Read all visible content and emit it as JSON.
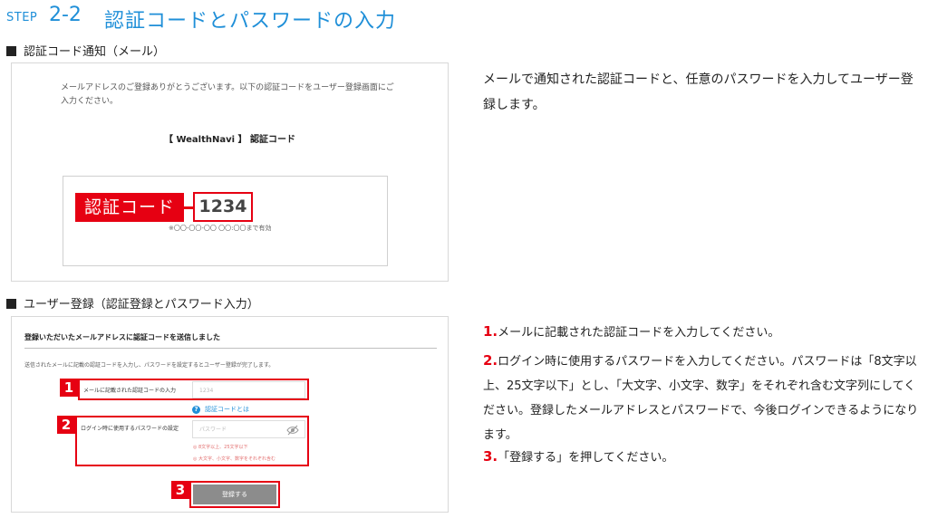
{
  "heading": {
    "step_label": "STEP",
    "step_number": "2-2",
    "title": "認証コードとパスワードの入力"
  },
  "section_email": {
    "title": "認証コード通知（メール）",
    "mail_body": "メールアドレスのご登録ありがとうございます。以下の認証コードをユーザー登録画面にご入力ください。",
    "brand_line": "【 WealthNavi 】 認証コード",
    "code_tag": "認証コード",
    "code_value": "1234",
    "valid_until": "※〇〇-〇〇-〇〇 〇〇:〇〇まで有効"
  },
  "intro_text": "メールで通知された認証コードと、任意のパスワードを入力してユーザー登録します。",
  "section_register": {
    "title": "ユーザー登録（認証登録とパスワード入力）",
    "form_title": "登録いただいたメールアドレスに認証コードを送信しました",
    "form_desc": "送信されたメールに記載の認証コードを入力し、パスワードを設定するとユーザー登録が完了します。",
    "field1_label": "メールに記載された認証コードの入力",
    "field1_placeholder": "1234",
    "help_link": "認証コードとは",
    "field2_label": "ログイン時に使用するパスワードの設定",
    "field2_placeholder": "パスワード",
    "hint1": "8文字以上、25文字以下",
    "hint2": "大文字、小文字、数字をそれぞれ含む",
    "submit_label": "登録する",
    "badges": [
      "1",
      "2",
      "3"
    ]
  },
  "instructions": [
    {
      "num": "1.",
      "text": "メールに記載された認証コードを入力してください。"
    },
    {
      "num": "2.",
      "text": "ログイン時に使用するパスワードを入力してください。パスワードは「8文字以上、25文字以下」とし、「大文字、小文字、数字」をそれぞれ含む文字列にしてください。登録したメールアドレスとパスワードで、今後ログインできるようになります。"
    },
    {
      "num": "3.",
      "text": "「登録する」を押してください。"
    }
  ],
  "colors": {
    "accent_blue": "#1f8fd8",
    "accent_red": "#e60012",
    "button_gray": "#8c8c8c"
  }
}
